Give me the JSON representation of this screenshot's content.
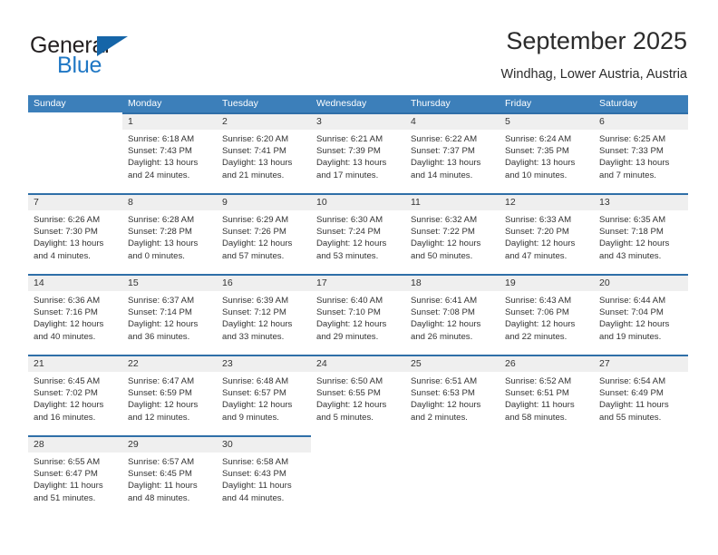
{
  "brand": {
    "word_one": "General",
    "word_two": "Blue",
    "triangle_icon": "blue-triangle-logo-mark",
    "accent_color": "#1f77c4",
    "mark_color": "#1565a8"
  },
  "header": {
    "title": "September 2025",
    "location": "Windhag, Lower Austria, Austria"
  },
  "theme": {
    "header_row_bg": "#3c7fba",
    "row_top_rule": "#2f6fa8",
    "daynum_band_bg": "#efefef",
    "text_color": "#333333"
  },
  "weekdays": [
    "Sunday",
    "Monday",
    "Tuesday",
    "Wednesday",
    "Thursday",
    "Friday",
    "Saturday"
  ],
  "weeks": [
    [
      {
        "day": "",
        "sunrise": "",
        "sunset": "",
        "daylight_1": "",
        "daylight_2": ""
      },
      {
        "day": "1",
        "sunrise": "Sunrise: 6:18 AM",
        "sunset": "Sunset: 7:43 PM",
        "daylight_1": "Daylight: 13 hours",
        "daylight_2": "and 24 minutes."
      },
      {
        "day": "2",
        "sunrise": "Sunrise: 6:20 AM",
        "sunset": "Sunset: 7:41 PM",
        "daylight_1": "Daylight: 13 hours",
        "daylight_2": "and 21 minutes."
      },
      {
        "day": "3",
        "sunrise": "Sunrise: 6:21 AM",
        "sunset": "Sunset: 7:39 PM",
        "daylight_1": "Daylight: 13 hours",
        "daylight_2": "and 17 minutes."
      },
      {
        "day": "4",
        "sunrise": "Sunrise: 6:22 AM",
        "sunset": "Sunset: 7:37 PM",
        "daylight_1": "Daylight: 13 hours",
        "daylight_2": "and 14 minutes."
      },
      {
        "day": "5",
        "sunrise": "Sunrise: 6:24 AM",
        "sunset": "Sunset: 7:35 PM",
        "daylight_1": "Daylight: 13 hours",
        "daylight_2": "and 10 minutes."
      },
      {
        "day": "6",
        "sunrise": "Sunrise: 6:25 AM",
        "sunset": "Sunset: 7:33 PM",
        "daylight_1": "Daylight: 13 hours",
        "daylight_2": "and 7 minutes."
      }
    ],
    [
      {
        "day": "7",
        "sunrise": "Sunrise: 6:26 AM",
        "sunset": "Sunset: 7:30 PM",
        "daylight_1": "Daylight: 13 hours",
        "daylight_2": "and 4 minutes."
      },
      {
        "day": "8",
        "sunrise": "Sunrise: 6:28 AM",
        "sunset": "Sunset: 7:28 PM",
        "daylight_1": "Daylight: 13 hours",
        "daylight_2": "and 0 minutes."
      },
      {
        "day": "9",
        "sunrise": "Sunrise: 6:29 AM",
        "sunset": "Sunset: 7:26 PM",
        "daylight_1": "Daylight: 12 hours",
        "daylight_2": "and 57 minutes."
      },
      {
        "day": "10",
        "sunrise": "Sunrise: 6:30 AM",
        "sunset": "Sunset: 7:24 PM",
        "daylight_1": "Daylight: 12 hours",
        "daylight_2": "and 53 minutes."
      },
      {
        "day": "11",
        "sunrise": "Sunrise: 6:32 AM",
        "sunset": "Sunset: 7:22 PM",
        "daylight_1": "Daylight: 12 hours",
        "daylight_2": "and 50 minutes."
      },
      {
        "day": "12",
        "sunrise": "Sunrise: 6:33 AM",
        "sunset": "Sunset: 7:20 PM",
        "daylight_1": "Daylight: 12 hours",
        "daylight_2": "and 47 minutes."
      },
      {
        "day": "13",
        "sunrise": "Sunrise: 6:35 AM",
        "sunset": "Sunset: 7:18 PM",
        "daylight_1": "Daylight: 12 hours",
        "daylight_2": "and 43 minutes."
      }
    ],
    [
      {
        "day": "14",
        "sunrise": "Sunrise: 6:36 AM",
        "sunset": "Sunset: 7:16 PM",
        "daylight_1": "Daylight: 12 hours",
        "daylight_2": "and 40 minutes."
      },
      {
        "day": "15",
        "sunrise": "Sunrise: 6:37 AM",
        "sunset": "Sunset: 7:14 PM",
        "daylight_1": "Daylight: 12 hours",
        "daylight_2": "and 36 minutes."
      },
      {
        "day": "16",
        "sunrise": "Sunrise: 6:39 AM",
        "sunset": "Sunset: 7:12 PM",
        "daylight_1": "Daylight: 12 hours",
        "daylight_2": "and 33 minutes."
      },
      {
        "day": "17",
        "sunrise": "Sunrise: 6:40 AM",
        "sunset": "Sunset: 7:10 PM",
        "daylight_1": "Daylight: 12 hours",
        "daylight_2": "and 29 minutes."
      },
      {
        "day": "18",
        "sunrise": "Sunrise: 6:41 AM",
        "sunset": "Sunset: 7:08 PM",
        "daylight_1": "Daylight: 12 hours",
        "daylight_2": "and 26 minutes."
      },
      {
        "day": "19",
        "sunrise": "Sunrise: 6:43 AM",
        "sunset": "Sunset: 7:06 PM",
        "daylight_1": "Daylight: 12 hours",
        "daylight_2": "and 22 minutes."
      },
      {
        "day": "20",
        "sunrise": "Sunrise: 6:44 AM",
        "sunset": "Sunset: 7:04 PM",
        "daylight_1": "Daylight: 12 hours",
        "daylight_2": "and 19 minutes."
      }
    ],
    [
      {
        "day": "21",
        "sunrise": "Sunrise: 6:45 AM",
        "sunset": "Sunset: 7:02 PM",
        "daylight_1": "Daylight: 12 hours",
        "daylight_2": "and 16 minutes."
      },
      {
        "day": "22",
        "sunrise": "Sunrise: 6:47 AM",
        "sunset": "Sunset: 6:59 PM",
        "daylight_1": "Daylight: 12 hours",
        "daylight_2": "and 12 minutes."
      },
      {
        "day": "23",
        "sunrise": "Sunrise: 6:48 AM",
        "sunset": "Sunset: 6:57 PM",
        "daylight_1": "Daylight: 12 hours",
        "daylight_2": "and 9 minutes."
      },
      {
        "day": "24",
        "sunrise": "Sunrise: 6:50 AM",
        "sunset": "Sunset: 6:55 PM",
        "daylight_1": "Daylight: 12 hours",
        "daylight_2": "and 5 minutes."
      },
      {
        "day": "25",
        "sunrise": "Sunrise: 6:51 AM",
        "sunset": "Sunset: 6:53 PM",
        "daylight_1": "Daylight: 12 hours",
        "daylight_2": "and 2 minutes."
      },
      {
        "day": "26",
        "sunrise": "Sunrise: 6:52 AM",
        "sunset": "Sunset: 6:51 PM",
        "daylight_1": "Daylight: 11 hours",
        "daylight_2": "and 58 minutes."
      },
      {
        "day": "27",
        "sunrise": "Sunrise: 6:54 AM",
        "sunset": "Sunset: 6:49 PM",
        "daylight_1": "Daylight: 11 hours",
        "daylight_2": "and 55 minutes."
      }
    ],
    [
      {
        "day": "28",
        "sunrise": "Sunrise: 6:55 AM",
        "sunset": "Sunset: 6:47 PM",
        "daylight_1": "Daylight: 11 hours",
        "daylight_2": "and 51 minutes."
      },
      {
        "day": "29",
        "sunrise": "Sunrise: 6:57 AM",
        "sunset": "Sunset: 6:45 PM",
        "daylight_1": "Daylight: 11 hours",
        "daylight_2": "and 48 minutes."
      },
      {
        "day": "30",
        "sunrise": "Sunrise: 6:58 AM",
        "sunset": "Sunset: 6:43 PM",
        "daylight_1": "Daylight: 11 hours",
        "daylight_2": "and 44 minutes."
      },
      {
        "day": "",
        "sunrise": "",
        "sunset": "",
        "daylight_1": "",
        "daylight_2": ""
      },
      {
        "day": "",
        "sunrise": "",
        "sunset": "",
        "daylight_1": "",
        "daylight_2": ""
      },
      {
        "day": "",
        "sunrise": "",
        "sunset": "",
        "daylight_1": "",
        "daylight_2": ""
      },
      {
        "day": "",
        "sunrise": "",
        "sunset": "",
        "daylight_1": "",
        "daylight_2": ""
      }
    ]
  ]
}
